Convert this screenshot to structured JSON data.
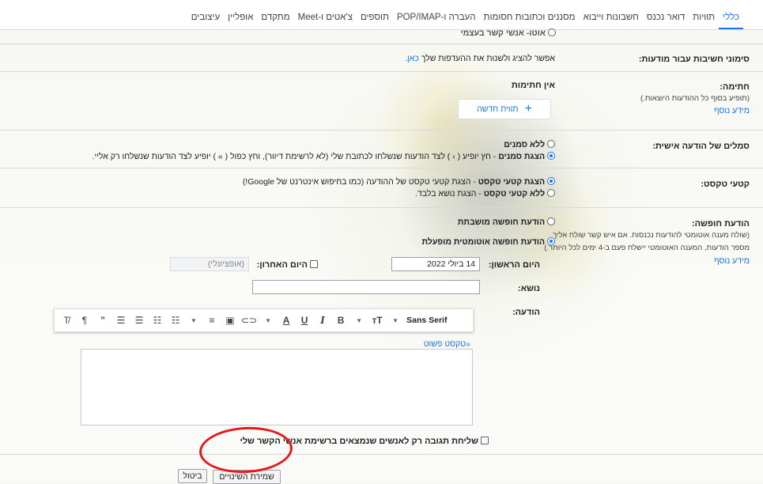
{
  "tabs": [
    "כללי",
    "תוויות",
    "דואר נכנס",
    "חשבונות וייבוא",
    "מסננים וכתובות חסומות",
    "העברה ו-POP/IMAP",
    "תוספים",
    "צ'אטים ו-Meet",
    "מתקדם",
    "אופליין",
    "עיצובים"
  ],
  "top_cut_text": "אוטו- אנשי קשר בעצמי",
  "importance": {
    "label": "סימוני חשיבות עבור מודעות:",
    "text": "אפשר להציג ולשנות את ההעדפות שלך",
    "link": "כאן."
  },
  "signature": {
    "label": "חתימה:",
    "sub": "(תופיע בסוף כל ההודעות היוצאות.)",
    "learn_more": "מידע נוסף",
    "none": "אין חתימות",
    "new_button": "תווית חדשה"
  },
  "personal": {
    "label": "סמלים של הודעה אישית:",
    "opt1": "ללא סמנים",
    "opt2_bold": "הצגת סמנים",
    "opt2_rest": " - חץ יופיע ( › ) לצד הודעות שנשלחו לכתובת שלי (לא לרשימת דיוור), וחץ כפול ( » ) יופיע לצד הודעות שנשלחו רק אליי."
  },
  "snippets": {
    "label": "קטעי טקסט:",
    "opt1_bold": "הצגת קטעי טקסט",
    "opt1_rest": " - הצגת קטעי טקסט של ההודעה (כמו בחיפוש אינטרנט של Google!)",
    "opt2_bold": "ללא קטעי טקסט",
    "opt2_rest": " - הצגת נושא בלבד."
  },
  "vacation": {
    "label": "הודעת חופשה:",
    "sub1": "(שולח מענה אוטומטי להודעות נכנסות. אם איש קשר שולח אליך",
    "sub2": "מספר הודעות, המענה האוטומטי יישלח פעם ב-4 ימים לכל היותר.)",
    "learn_more": "מידע נוסף",
    "off": "הודעת חופשה מושבתת",
    "on": "הודעת חופשה אוטומטית מופעלת",
    "first_day_label": "היום הראשון:",
    "first_day_value": "14 ביולי 2022",
    "last_day_label": "היום האחרון:",
    "last_day_placeholder": "(אופציונלי)",
    "subject_label": "נושא:",
    "message_label": "הודעה:",
    "font": "Sans Serif",
    "plain_text": "«טקסט פשוט",
    "contacts_only": "שליחת תגובה רק לאנשים שנמצאים ברשימת אנשי הקשר שלי"
  },
  "footer": {
    "save": "שמירת השינויים",
    "cancel": "ביטול"
  },
  "annotation_color": "#e31a1a"
}
